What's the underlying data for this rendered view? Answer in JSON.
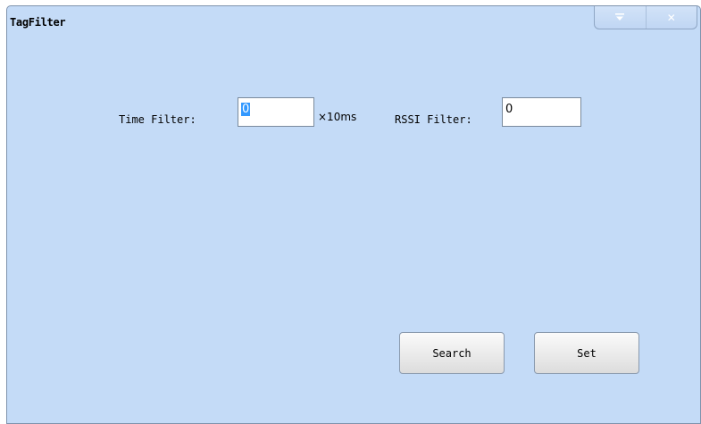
{
  "window": {
    "title": "TagFilter",
    "caption_buttons": [
      {
        "icon": "dropdown-icon"
      },
      {
        "icon": "close-icon",
        "glyph": "✕"
      }
    ]
  },
  "form": {
    "time_filter_label": "Time Filter:",
    "time_filter_value": "0",
    "time_filter_unit": "×10ms",
    "rssi_filter_label": "RSSI Filter:",
    "rssi_filter_value": "0"
  },
  "buttons": {
    "search_label": "Search",
    "set_label": "Set"
  },
  "colors": {
    "background": "#c4dbf7",
    "selection": "#3399ff"
  }
}
